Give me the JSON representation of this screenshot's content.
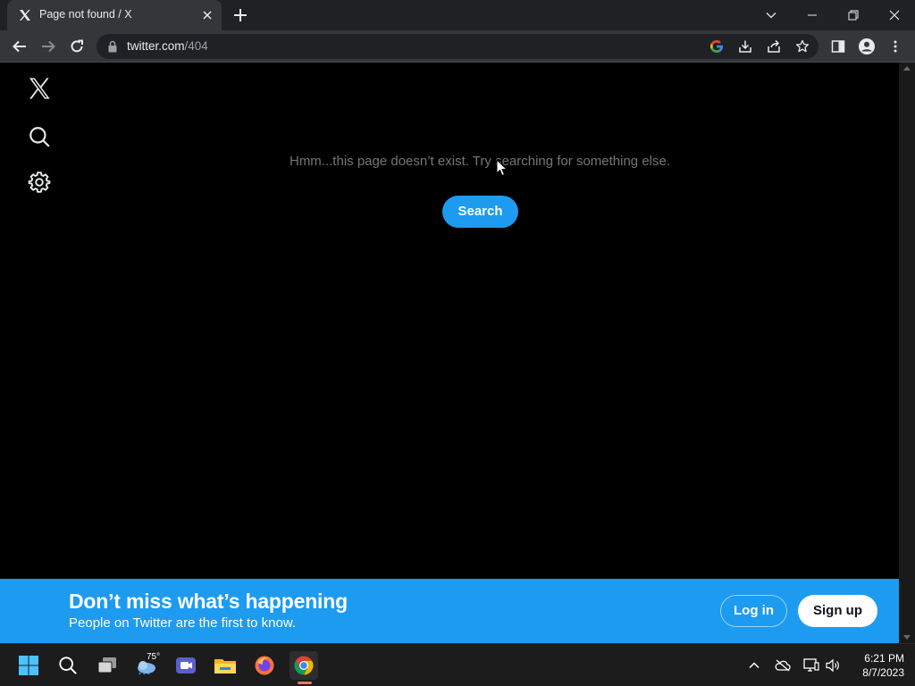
{
  "browser": {
    "tab_title": "Page not found / X",
    "url_host": "twitter.com",
    "url_path": "/404"
  },
  "page": {
    "message": "Hmm...this page doesn’t exist. Try searching for something else.",
    "search_button": "Search"
  },
  "banner": {
    "title": "Don’t miss what’s happening",
    "subtitle": "People on Twitter are the first to know.",
    "login_button": "Log in",
    "signup_button": "Sign up"
  },
  "taskbar": {
    "weather_temp": "75°",
    "time": "6:21 PM",
    "date": "8/7/2023"
  },
  "icons": {
    "sidebar": [
      "x-logo-icon",
      "search-icon",
      "gear-icon"
    ],
    "toolbar": [
      "back-icon",
      "forward-icon",
      "reload-icon",
      "lock-icon",
      "google-icon",
      "install-icon",
      "share-icon",
      "star-icon",
      "side-panel-icon",
      "profile-icon",
      "more-icon"
    ]
  },
  "colors": {
    "brand_blue": "#1d9bf0",
    "page_background": "#000000",
    "message_text": "#71767b"
  }
}
